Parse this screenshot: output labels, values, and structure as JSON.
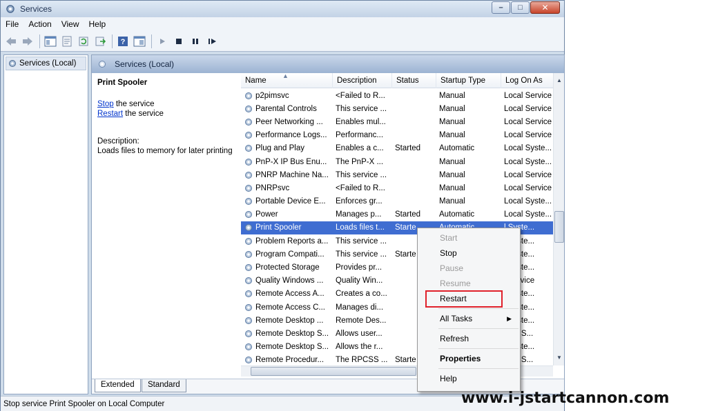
{
  "window": {
    "title": "Services",
    "menu": [
      "File",
      "Action",
      "View",
      "Help"
    ]
  },
  "tree": {
    "root_label": "Services (Local)"
  },
  "main": {
    "header_title": "Services (Local)",
    "selected_service": "Print Spooler",
    "stop_link": "Stop",
    "stop_suffix": " the service",
    "restart_link": "Restart",
    "restart_suffix": " the service",
    "description_label": "Description:",
    "description_text": "Loads files to memory for later printing"
  },
  "columns": [
    "Name",
    "Description",
    "Status",
    "Startup Type",
    "Log On As"
  ],
  "services": [
    {
      "name": "p2pimsvc",
      "desc": "<Failed to R...",
      "status": "",
      "startup": "Manual",
      "logon": "Local Service"
    },
    {
      "name": "Parental Controls",
      "desc": "This service ...",
      "status": "",
      "startup": "Manual",
      "logon": "Local Service"
    },
    {
      "name": "Peer Networking ...",
      "desc": "Enables mul...",
      "status": "",
      "startup": "Manual",
      "logon": "Local Service"
    },
    {
      "name": "Performance Logs...",
      "desc": "Performanc...",
      "status": "",
      "startup": "Manual",
      "logon": "Local Service"
    },
    {
      "name": "Plug and Play",
      "desc": "Enables a c...",
      "status": "Started",
      "startup": "Automatic",
      "logon": "Local Syste..."
    },
    {
      "name": "PnP-X IP Bus Enu...",
      "desc": "The PnP-X ...",
      "status": "",
      "startup": "Manual",
      "logon": "Local Syste..."
    },
    {
      "name": "PNRP Machine Na...",
      "desc": "This service ...",
      "status": "",
      "startup": "Manual",
      "logon": "Local Service"
    },
    {
      "name": "PNRPsvc",
      "desc": "<Failed to R...",
      "status": "",
      "startup": "Manual",
      "logon": "Local Service"
    },
    {
      "name": "Portable Device E...",
      "desc": "Enforces gr...",
      "status": "",
      "startup": "Manual",
      "logon": "Local Syste..."
    },
    {
      "name": "Power",
      "desc": "Manages p...",
      "status": "Started",
      "startup": "Automatic",
      "logon": "Local Syste..."
    },
    {
      "name": "Print Spooler",
      "desc": "Loads files t...",
      "status": "Starte",
      "startup": "Automatic",
      "logon": "l Syste...",
      "selected": true
    },
    {
      "name": "Problem Reports a...",
      "desc": "This service ...",
      "status": "",
      "startup": "",
      "logon": "l Syste..."
    },
    {
      "name": "Program Compati...",
      "desc": "This service ...",
      "status": "Starte",
      "startup": "",
      "logon": "l Syste..."
    },
    {
      "name": "Protected Storage",
      "desc": "Provides pr...",
      "status": "",
      "startup": "",
      "logon": "l Syste..."
    },
    {
      "name": "Quality Windows ...",
      "desc": "Quality Win...",
      "status": "",
      "startup": "",
      "logon": "l Service"
    },
    {
      "name": "Remote Access A...",
      "desc": "Creates a co...",
      "status": "",
      "startup": "",
      "logon": "l Syste..."
    },
    {
      "name": "Remote Access C...",
      "desc": "Manages di...",
      "status": "",
      "startup": "",
      "logon": "l Syste..."
    },
    {
      "name": "Remote Desktop ...",
      "desc": "Remote Des...",
      "status": "",
      "startup": "",
      "logon": "l Syste..."
    },
    {
      "name": "Remote Desktop S...",
      "desc": "Allows user...",
      "status": "",
      "startup": "",
      "logon": "vork S..."
    },
    {
      "name": "Remote Desktop S...",
      "desc": "Allows the r...",
      "status": "",
      "startup": "",
      "logon": "l Syste..."
    },
    {
      "name": "Remote Procedur...",
      "desc": "The RPCSS ...",
      "status": "Starte",
      "startup": "",
      "logon": "vork S..."
    }
  ],
  "tabs": {
    "extended": "Extended",
    "standard": "Standard"
  },
  "context_menu": {
    "start": "Start",
    "stop": "Stop",
    "pause": "Pause",
    "resume": "Resume",
    "restart": "Restart",
    "all_tasks": "All Tasks",
    "refresh": "Refresh",
    "properties": "Properties",
    "help": "Help"
  },
  "statusbar": {
    "text": "Stop service Print Spooler on Local Computer"
  },
  "watermark": "www.i-jstartcannon.com",
  "colors": {
    "selection": "#3f6dd1",
    "highlight_box": "#e0202a",
    "header": "#9cb3d2"
  }
}
